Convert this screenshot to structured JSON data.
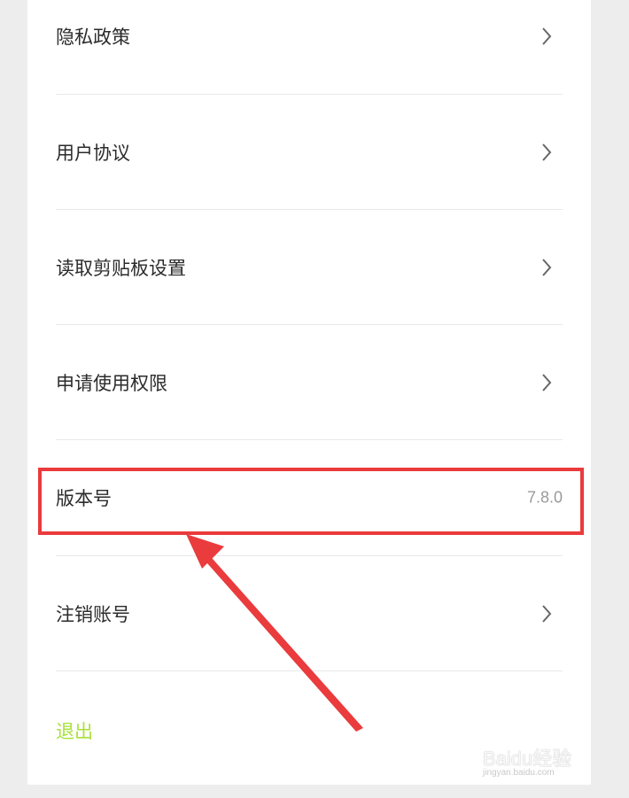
{
  "settings": {
    "items": [
      {
        "label": "隐私政策",
        "icon": "chevron-right-icon"
      },
      {
        "label": "用户协议",
        "icon": "chevron-right-icon"
      },
      {
        "label": "读取剪贴板设置",
        "icon": "chevron-right-icon"
      },
      {
        "label": "申请使用权限",
        "icon": "chevron-right-icon"
      },
      {
        "label": "版本号",
        "value": "7.8.0"
      },
      {
        "label": "注销账号",
        "icon": "chevron-right-icon"
      }
    ],
    "logout_label": "退出",
    "logout_color": "#a8e23a"
  },
  "annotation": {
    "highlight_color": "#ea3b3d",
    "arrow_color": "#ea3b3d"
  },
  "watermark": {
    "brand": "Baidu经验",
    "url": "jingyan.baidu.com"
  }
}
